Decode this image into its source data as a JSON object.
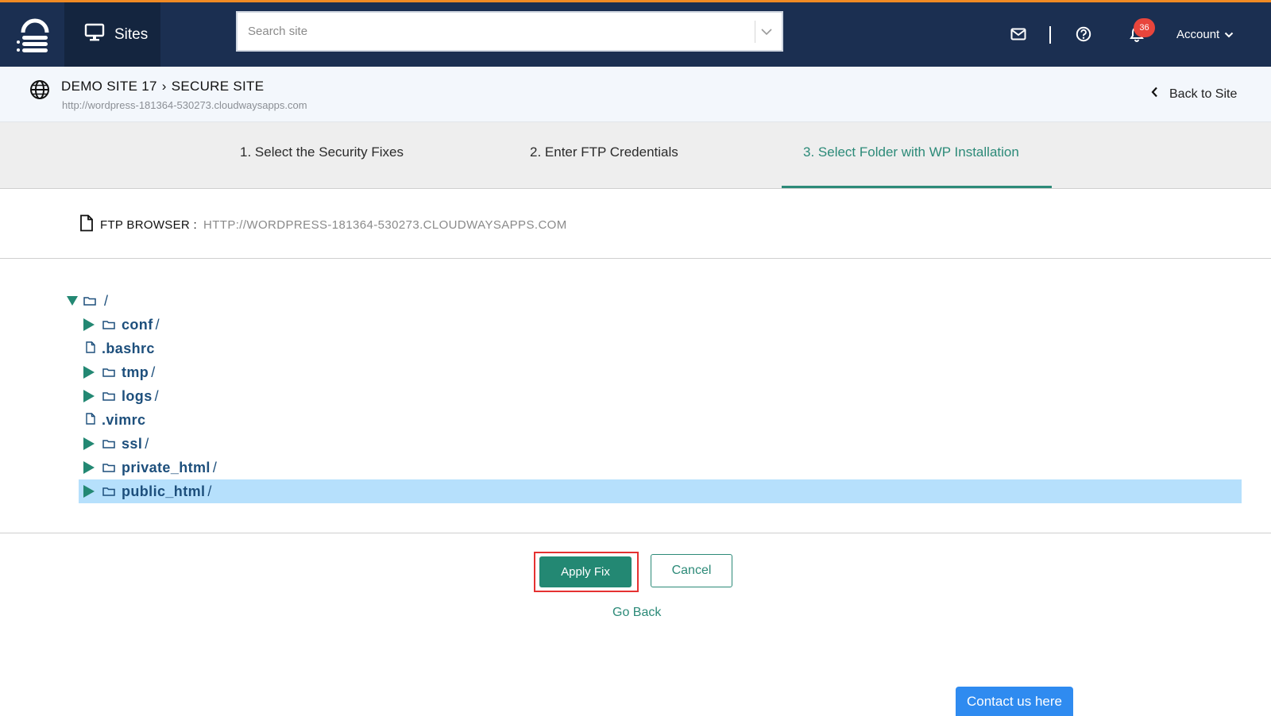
{
  "topbar": {
    "sites_label": "Sites",
    "search_placeholder": "Search site",
    "notification_count": "36",
    "account_label": "Account"
  },
  "site_header": {
    "site_name": "DEMO SITE 17",
    "separator": "›",
    "page_name": "SECURE SITE",
    "site_url": "http://wordpress-181364-530273.cloudwaysapps.com",
    "back_label": "Back to Site"
  },
  "steps": [
    {
      "label": "1. Select the Security Fixes",
      "active": false
    },
    {
      "label": "2. Enter FTP Credentials",
      "active": false
    },
    {
      "label": "3. Select Folder with WP Installation",
      "active": true
    }
  ],
  "ftp_browser": {
    "label": "FTP BROWSER :",
    "url": "HTTP://WORDPRESS-181364-530273.CLOUDWAYSAPPS.COM"
  },
  "tree": {
    "root": {
      "name": "/",
      "expanded": true
    },
    "items": [
      {
        "name": "conf",
        "type": "folder",
        "suffix": "/"
      },
      {
        "name": ".bashrc",
        "type": "file",
        "suffix": ""
      },
      {
        "name": "tmp",
        "type": "folder",
        "suffix": "/"
      },
      {
        "name": "logs",
        "type": "folder",
        "suffix": "/"
      },
      {
        "name": ".vimrc",
        "type": "file",
        "suffix": ""
      },
      {
        "name": "ssl",
        "type": "folder",
        "suffix": "/"
      },
      {
        "name": "private_html",
        "type": "folder",
        "suffix": "/"
      },
      {
        "name": "public_html",
        "type": "folder",
        "suffix": "/",
        "selected": true
      }
    ]
  },
  "actions": {
    "apply_label": "Apply Fix",
    "cancel_label": "Cancel",
    "go_back_label": "Go Back"
  },
  "contact_label": "Contact us here",
  "colors": {
    "topbar": "#1b2f51",
    "accent_orange": "#f08a24",
    "teal": "#238873",
    "tree_text": "#1d4f7c",
    "selected_row": "#b6e0fc",
    "badge": "#e8453c",
    "highlight_red": "#e53131",
    "contact_blue": "#2f8bf0"
  }
}
